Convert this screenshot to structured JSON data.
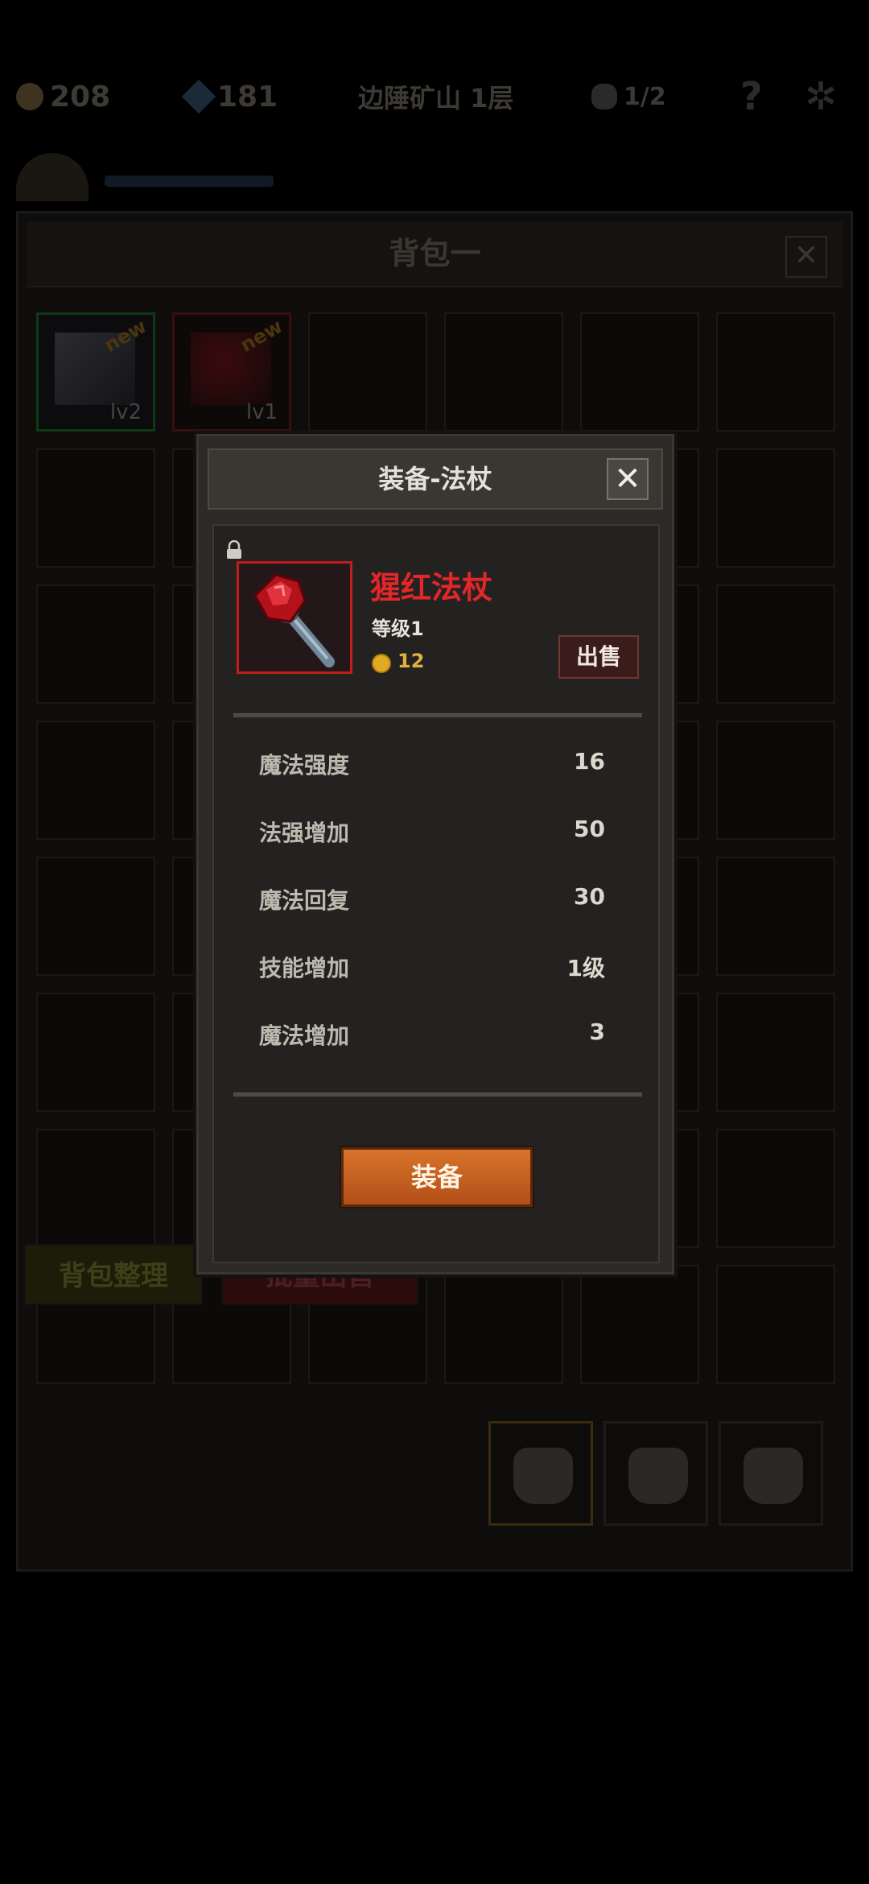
{
  "topbar": {
    "gold": "208",
    "gems": "181",
    "location": "边陲矿山 1层",
    "kills": "1/2",
    "help_icon": "question-icon",
    "settings_icon": "gear-icon"
  },
  "bag": {
    "title": "背包一",
    "items": [
      {
        "level": "lv2",
        "badge": "new",
        "border": "#0e3a14"
      },
      {
        "level": "lv1",
        "badge": "new",
        "border": "#3a0e0e"
      }
    ],
    "sort_label": "背包整理",
    "bulk_sell_label": "批量出售"
  },
  "modal": {
    "title": "装备-法杖",
    "item": {
      "name": "猩红法杖",
      "level": "等级1",
      "price": "12",
      "rarity_color": "#e3262a"
    },
    "sell_label": "出售",
    "stats": [
      {
        "label": "魔法强度",
        "value": "16"
      },
      {
        "label": "法强增加",
        "value": "50"
      },
      {
        "label": "魔法回复",
        "value": "30"
      },
      {
        "label": "技能增加",
        "value": "1级"
      },
      {
        "label": "魔法增加",
        "value": "3"
      }
    ],
    "equip_label": "装备"
  }
}
